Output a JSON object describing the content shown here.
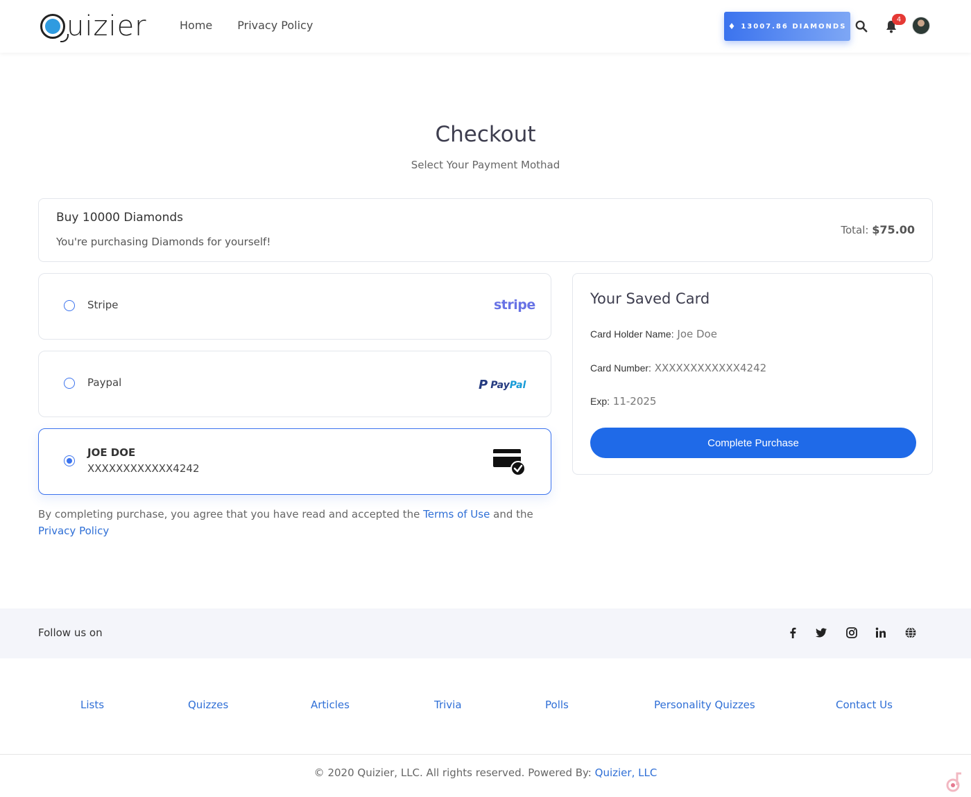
{
  "header": {
    "logo_text": "uizier",
    "nav": [
      "Home",
      "Privacy Policy"
    ],
    "diamonds_label": "13007.86 DIAMONDS",
    "notification_count": "4"
  },
  "page": {
    "title": "Checkout",
    "subtitle": "Select Your Payment Mothad"
  },
  "order": {
    "title": "Buy 10000 Diamonds",
    "description": "You're purchasing Diamonds for yourself!",
    "total_label": "Total:",
    "total_value": "$75.00"
  },
  "payment_options": [
    {
      "label": "Stripe",
      "brand": "stripe",
      "selected": false
    },
    {
      "label": "Paypal",
      "brand_part1": "Pay",
      "brand_part2": "Pal",
      "selected": false
    },
    {
      "name": "JOE DOE",
      "number": "XXXXXXXXXXXX4242",
      "selected": true
    }
  ],
  "terms": {
    "prefix": "By completing purchase, you agree that you have read and accepted the",
    "terms_link": "Terms of Use",
    "middle": "and the",
    "privacy_link": "Privacy Policy"
  },
  "saved_card": {
    "title": "Your Saved Card",
    "holder_label": "Card Holder Name:",
    "holder_value": "Joe Doe",
    "number_label": "Card Number:",
    "number_value": "XXXXXXXXXXXX4242",
    "exp_label": "Exp:",
    "exp_value": "11-2025",
    "button_label": "Complete Purchase"
  },
  "follow": {
    "label": "Follow us on",
    "icons": [
      "facebook-icon",
      "twitter-icon",
      "instagram-icon",
      "linkedin-icon",
      "globe-icon"
    ]
  },
  "footer": {
    "links": [
      "Lists",
      "Quizzes",
      "Articles",
      "Trivia",
      "Polls",
      "Personality Quizzes",
      "Contact Us"
    ],
    "copyright": "© 2020 Quizier, LLC. All rights reserved. Powered By:",
    "powered_link": "Quizier, LLC"
  },
  "colors": {
    "accent": "#1f6ae8",
    "link": "#2f6fd6",
    "badge": "#e53935"
  }
}
